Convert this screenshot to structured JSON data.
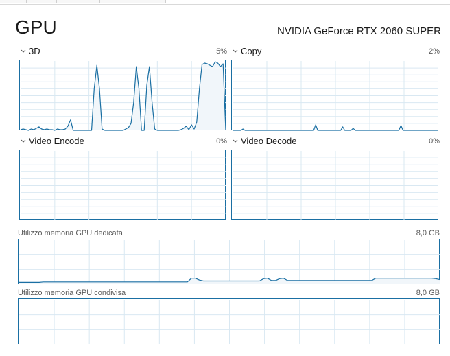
{
  "page": {
    "title": "GPU",
    "gpu_name": "NVIDIA GeForce RTX 2060 SUPER"
  },
  "colors": {
    "line": "#1a6fa3",
    "fill": "#f1f6fa",
    "grid": "#d9e8f2",
    "border": "#1a6fa3"
  },
  "engines": [
    {
      "id": "3d",
      "label": "3D",
      "value": "5%",
      "samples": [
        1,
        2,
        1,
        0,
        2,
        1,
        3,
        5,
        2,
        1,
        2,
        1,
        1,
        0,
        2,
        1,
        1,
        2,
        6,
        15,
        0,
        0,
        0,
        0,
        0,
        0,
        0,
        0,
        60,
        94,
        60,
        2,
        0,
        0,
        0,
        0,
        0,
        0,
        0,
        0,
        2,
        4,
        10,
        40,
        92,
        60,
        0,
        0,
        65,
        92,
        40,
        2,
        0,
        0,
        0,
        0,
        0,
        0,
        0,
        0,
        0,
        1,
        3,
        6,
        1,
        8,
        2,
        12,
        60,
        95,
        97,
        96,
        94,
        92,
        99,
        97,
        92,
        96,
        0
      ]
    },
    {
      "id": "copy",
      "label": "Copy",
      "value": "2%",
      "samples": [
        0,
        0,
        0,
        0,
        0,
        2,
        0,
        0,
        0,
        0,
        0,
        0,
        0,
        0,
        0,
        0,
        0,
        0,
        0,
        0,
        0,
        0,
        0,
        0,
        0,
        0,
        0,
        0,
        0,
        0,
        0,
        0,
        0,
        0,
        0,
        0,
        0,
        0,
        0,
        0,
        8,
        0,
        0,
        0,
        0,
        0,
        0,
        0,
        0,
        0,
        0,
        0,
        0,
        5,
        0,
        0,
        0,
        0,
        3,
        0,
        0,
        0,
        0,
        0,
        0,
        0,
        0,
        0,
        0,
        0,
        0,
        0,
        0,
        0,
        0,
        0,
        0,
        0,
        0,
        0,
        0,
        7,
        0,
        0,
        0,
        0,
        0,
        0,
        0,
        0,
        0,
        0,
        0,
        0,
        0,
        0,
        0,
        0,
        0,
        0
      ]
    },
    {
      "id": "video-encode",
      "label": "Video Encode",
      "value": "0%",
      "samples": []
    },
    {
      "id": "video-decode",
      "label": "Video Decode",
      "value": "0%",
      "samples": []
    }
  ],
  "memory": [
    {
      "id": "dedicated",
      "label": "Utilizzo memoria GPU dedicata",
      "value": "8,0 GB",
      "samples": [
        4,
        4,
        4,
        4,
        4,
        4,
        5,
        5,
        5,
        5,
        5,
        5,
        5,
        5,
        5,
        5,
        5,
        5,
        5,
        5,
        5,
        5,
        5,
        5,
        5,
        5,
        5,
        5,
        5,
        5,
        5,
        5,
        5,
        5,
        5,
        5,
        5,
        5,
        5,
        5,
        5,
        5,
        5,
        13,
        13,
        9,
        7,
        7,
        7,
        7,
        7,
        7,
        7,
        7,
        7,
        7,
        7,
        7,
        7,
        7,
        7,
        12,
        13,
        8,
        8,
        12,
        13,
        8,
        8,
        8,
        8,
        8,
        8,
        8,
        8,
        8,
        8,
        8,
        8,
        8,
        8,
        8,
        8,
        8,
        8,
        8,
        8,
        8,
        8,
        13,
        13,
        13,
        13,
        13,
        13,
        13,
        13,
        13,
        13,
        13,
        13,
        13,
        13,
        13,
        12,
        10
      ]
    },
    {
      "id": "shared",
      "label": "Utilizzo memoria GPU condivisa",
      "value": "8,0 GB",
      "samples": []
    }
  ]
}
